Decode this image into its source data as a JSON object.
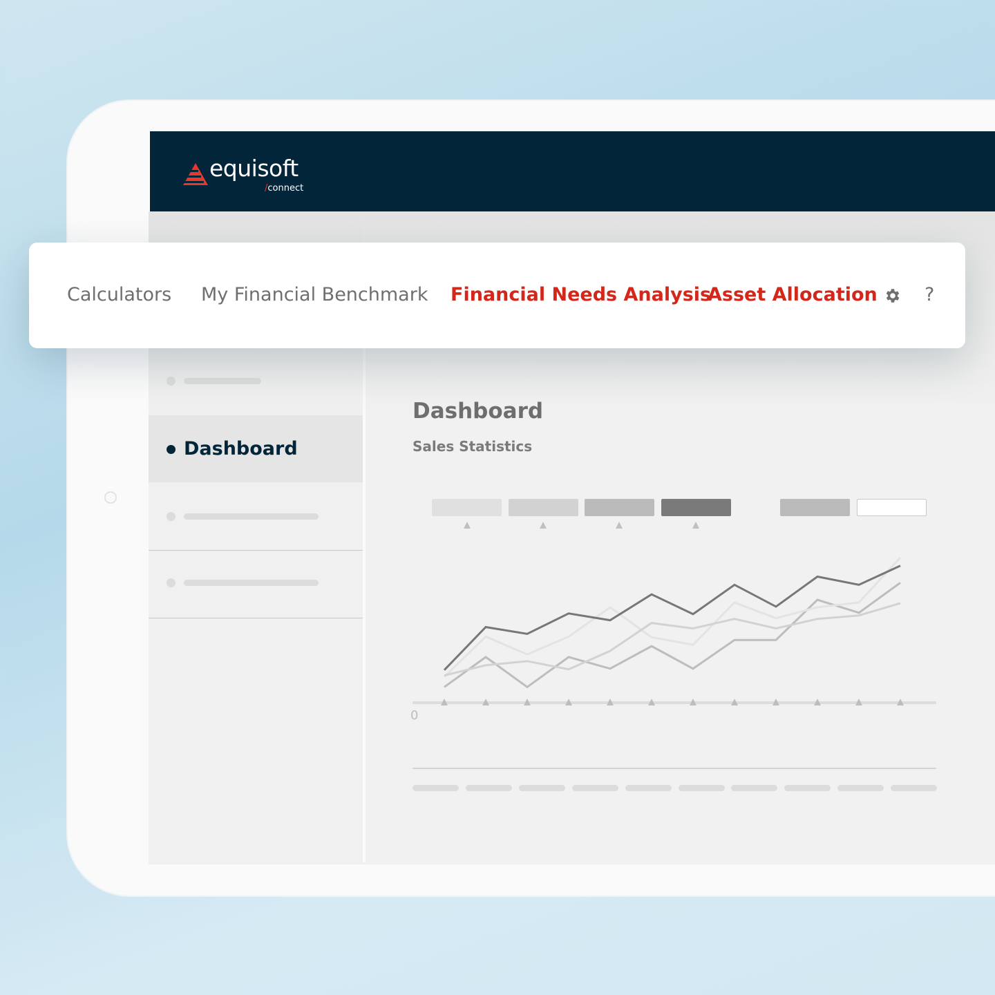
{
  "brand": {
    "name": "equisoft",
    "product": "connect",
    "slash": "/",
    "accent": "#e8372b",
    "header_color": "#02253a"
  },
  "nav": {
    "items": [
      {
        "label": "Calculators",
        "active": false
      },
      {
        "label": "My Financial Benchmark",
        "active": false
      },
      {
        "label": "Financial Needs Analysis",
        "active": true
      },
      {
        "label": "Asset Allocation",
        "active": true
      }
    ],
    "settings_icon": "gear-icon",
    "help_label": "?",
    "active_color": "#d4271b"
  },
  "sidebar": {
    "active_label": "Dashboard"
  },
  "main": {
    "title": "Dashboard",
    "subtitle": "Sales Statistics"
  },
  "chart_data": {
    "type": "line",
    "title": "",
    "xlabel": "",
    "ylabel": "",
    "y_tick_labels": [
      "0"
    ],
    "ylim": [
      0,
      220
    ],
    "grid": false,
    "legend": "top",
    "legend_colors": [
      "#e0e0e0",
      "#d2d2d2",
      "#bbbbbb",
      "#7a7a7a",
      "#bbbbbb",
      "#ffffff"
    ],
    "x": [
      1,
      2,
      3,
      4,
      5,
      6,
      7,
      8,
      9,
      10,
      11,
      12
    ],
    "series": [
      {
        "color": "#777777",
        "values": [
          48,
          111,
          101,
          131,
          121,
          159,
          130,
          173,
          141,
          185,
          173,
          201
        ]
      },
      {
        "color": "#e3e3e3",
        "values": [
          38,
          97,
          71,
          97,
          140,
          96,
          85,
          147,
          124,
          140,
          147,
          213
        ]
      },
      {
        "color": "#d2d2d2",
        "values": [
          40,
          55,
          61,
          49,
          76,
          117,
          109,
          123,
          109,
          123,
          128,
          146
        ]
      },
      {
        "color": "#bdbdbd",
        "values": [
          23,
          67,
          23,
          67,
          50,
          83,
          50,
          92,
          92,
          151,
          132,
          176
        ]
      }
    ]
  }
}
